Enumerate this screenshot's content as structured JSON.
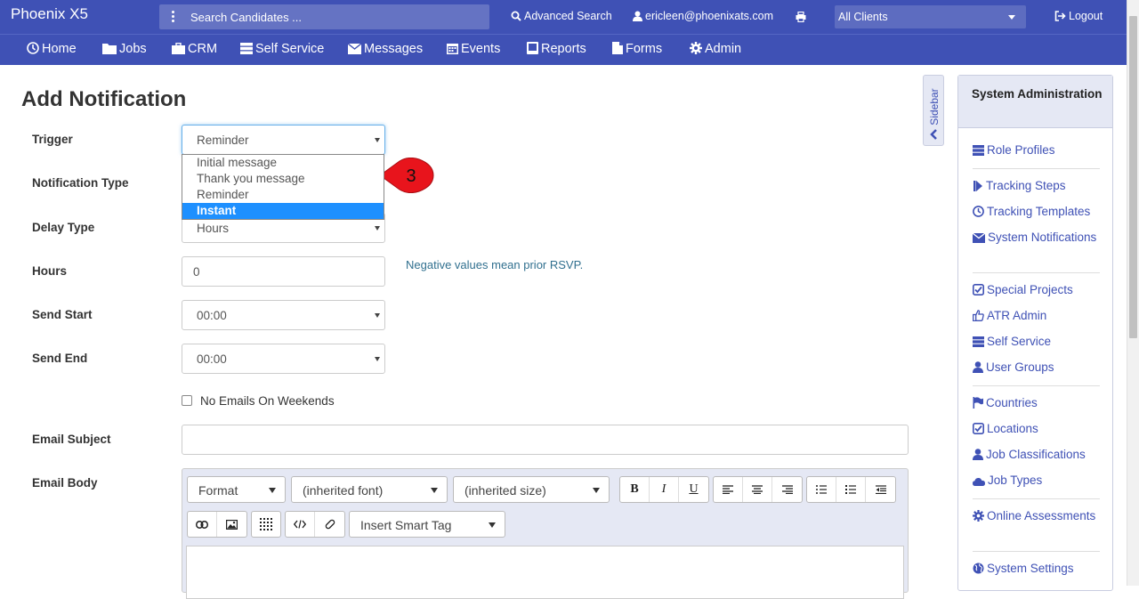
{
  "header": {
    "brand": "Phoenix X5",
    "search_placeholder": "Search Candidates ...",
    "advanced_search": "Advanced Search",
    "user_email": "ericleen@phoenixats.com",
    "client_select": "All Clients",
    "logout": "Logout"
  },
  "nav": {
    "items": [
      {
        "label": "Home",
        "icon": "home-icon"
      },
      {
        "label": "Jobs",
        "icon": "folder-icon"
      },
      {
        "label": "CRM",
        "icon": "briefcase-icon"
      },
      {
        "label": "Self Service",
        "icon": "server-icon"
      },
      {
        "label": "Messages",
        "icon": "envelope-icon"
      },
      {
        "label": "Events",
        "icon": "calendar-icon"
      },
      {
        "label": "Reports",
        "icon": "book-icon"
      },
      {
        "label": "Forms",
        "icon": "file-icon"
      },
      {
        "label": "Admin",
        "icon": "gear-icon"
      }
    ]
  },
  "form": {
    "title": "Add Notification",
    "trigger_label": "Trigger",
    "trigger_value": "Reminder",
    "trigger_options": [
      "Initial message",
      "Thank you message",
      "Reminder",
      "Instant"
    ],
    "trigger_highlighted": "Instant",
    "notification_type_label": "Notification Type",
    "delay_type_label": "Delay Type",
    "delay_type_value": "Hours",
    "hours_label": "Hours",
    "hours_value": "0",
    "hours_hint": "Negative values mean prior RSVP.",
    "send_start_label": "Send Start",
    "send_start_value": "00:00",
    "send_end_label": "Send End",
    "send_end_value": "00:00",
    "no_emails_weekends": "No Emails On Weekends",
    "email_subject_label": "Email Subject",
    "email_subject_value": "",
    "email_body_label": "Email Body"
  },
  "editor": {
    "format": "Format",
    "font": "(inherited font)",
    "size": "(inherited size)",
    "bold": "B",
    "italic": "I",
    "underline": "U",
    "smart_tag": "Insert Smart Tag"
  },
  "callout": {
    "number": "3",
    "color": "#e8141c"
  },
  "sidebar": {
    "tab_label": "Sidebar",
    "title": "System Administration",
    "items": [
      {
        "label": "Role Profiles",
        "icon": "server-icon"
      },
      {
        "label": "Tracking Steps",
        "icon": "step-forward-icon"
      },
      {
        "label": "Tracking Templates",
        "icon": "clock-icon"
      },
      {
        "label": "System Notifications",
        "icon": "envelope-icon"
      },
      {
        "label": "Special Projects",
        "icon": "check-square-icon"
      },
      {
        "label": "ATR Admin",
        "icon": "thumbs-up-icon"
      },
      {
        "label": "Self Service",
        "icon": "server-icon"
      },
      {
        "label": "User Groups",
        "icon": "user-icon"
      },
      {
        "label": "Countries",
        "icon": "flag-icon"
      },
      {
        "label": "Locations",
        "icon": "check-square-icon"
      },
      {
        "label": "Job Classifications",
        "icon": "user-icon"
      },
      {
        "label": "Job Types",
        "icon": "cloud-icon"
      },
      {
        "label": "Online Assessments",
        "icon": "gear-icon"
      },
      {
        "label": "System Settings",
        "icon": "globe-icon"
      }
    ]
  },
  "colors": {
    "primary": "#3f51b5",
    "link": "#3f51b5",
    "hint": "#31708f",
    "highlight": "#1e90ff"
  }
}
